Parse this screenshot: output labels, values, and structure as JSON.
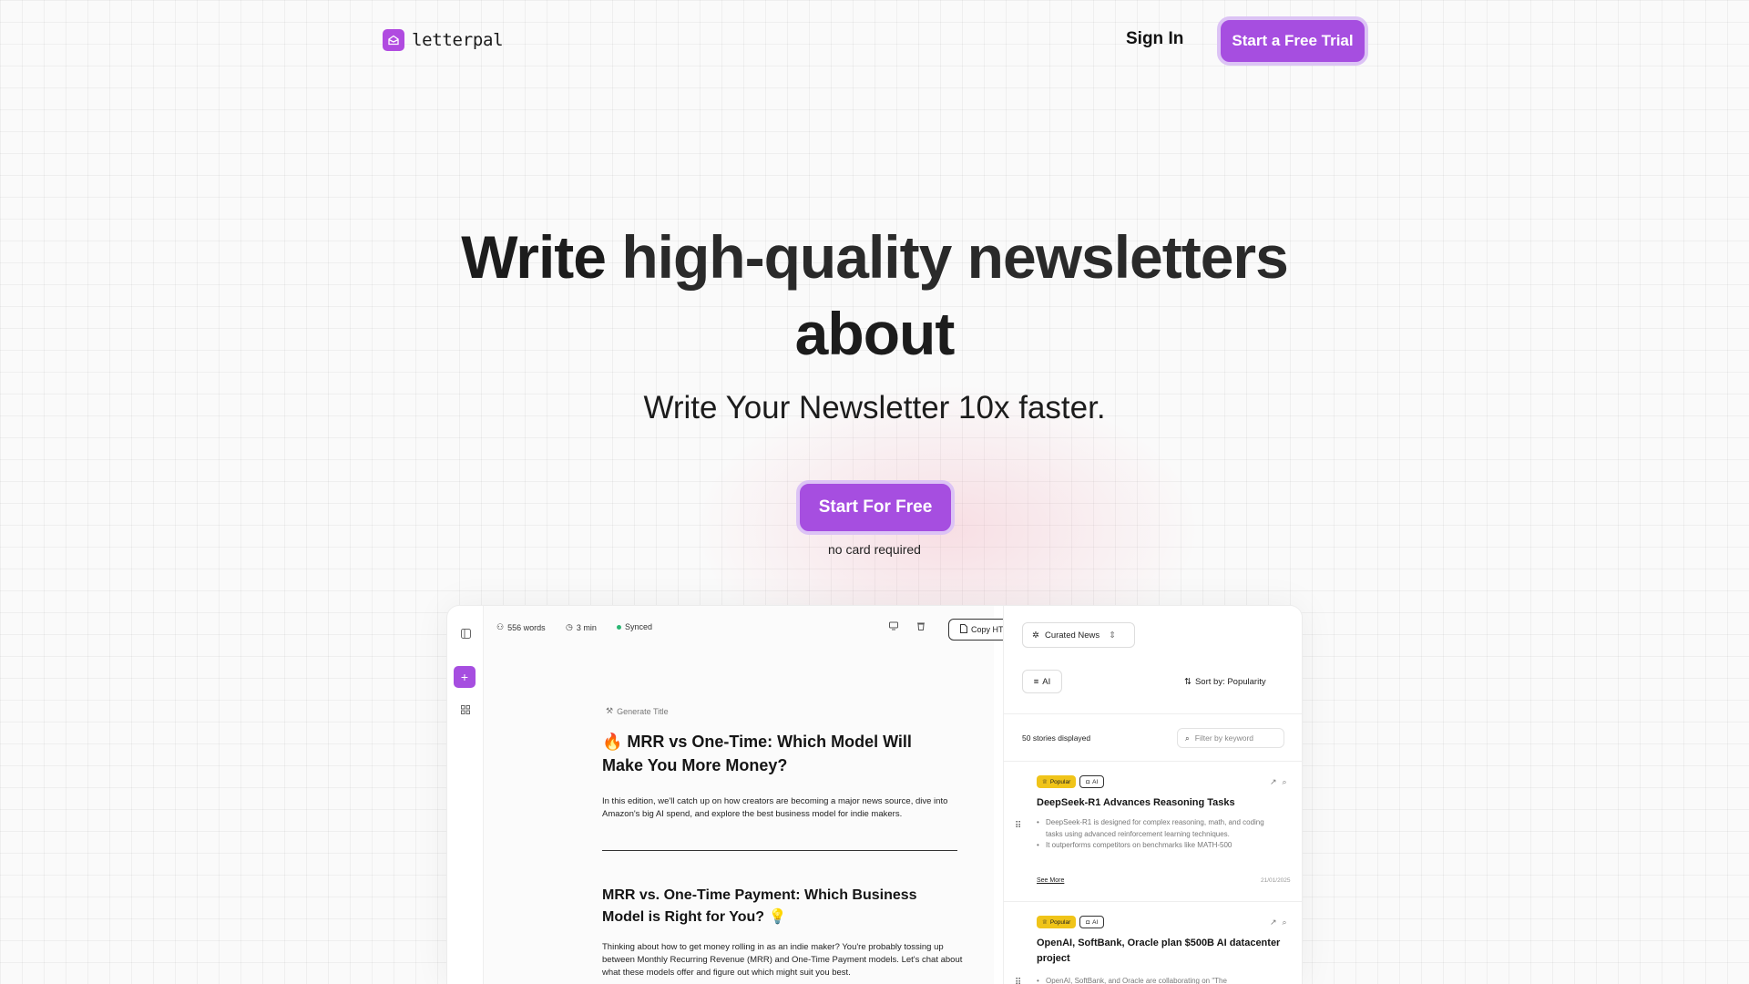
{
  "brand": {
    "name": "letterpal",
    "accent": "#a64ee0"
  },
  "nav": {
    "sign_in": "Sign In",
    "trial_button": "Start a Free Trial"
  },
  "hero": {
    "title_start": "Write ",
    "title_bold": "high-quality newsletters",
    "title_end": "about",
    "subtitle": "Write Your Newsletter 10x faster.",
    "cta": "Start For Free",
    "cta_note": "no card required"
  },
  "editor": {
    "word_count": "556 words",
    "read_time": "3 min",
    "sync_status": "Synced",
    "copy_button": "Copy HTML",
    "generate_title": "Generate Title",
    "doc_title": "🔥 MRR vs One-Time: Which Model Will Make You More Money?",
    "doc_intro": "In this edition, we'll catch up on how creators are becoming a major news source, dive into Amazon's big AI spend, and explore the best business model for indie makers.",
    "section_title": "MRR vs. One-Time Payment: Which Business Model is Right for You? 💡",
    "section_body": "Thinking about how to get money rolling in as an indie maker? You're probably tossing up between Monthly Recurring Revenue (MRR) and One-Time Payment models. Let's chat about what these models offer and figure out which might suit you best."
  },
  "panel": {
    "source_select": "Curated News",
    "topic_chip": "AI",
    "sort_label": "Sort by: Popularity",
    "stories_count": "50 stories displayed",
    "filter_placeholder": "Filter by keyword",
    "items": [
      {
        "badge_popular": "Popular",
        "badge_topic": "AI",
        "title": "DeepSeek-R1 Advances Reasoning Tasks",
        "bullets": [
          "DeepSeek-R1 is designed for complex reasoning, math, and coding tasks using advanced reinforcement learning techniques.",
          "It outperforms competitors on benchmarks like MATH-500"
        ],
        "see_more": "See More",
        "date": "21/01/2025"
      },
      {
        "badge_popular": "Popular",
        "badge_topic": "AI",
        "title": "OpenAI, SoftBank, Oracle plan $500B AI datacenter project",
        "bullets": [
          "OpenAI, SoftBank, and Oracle are collaborating on \"The"
        ]
      }
    ]
  }
}
